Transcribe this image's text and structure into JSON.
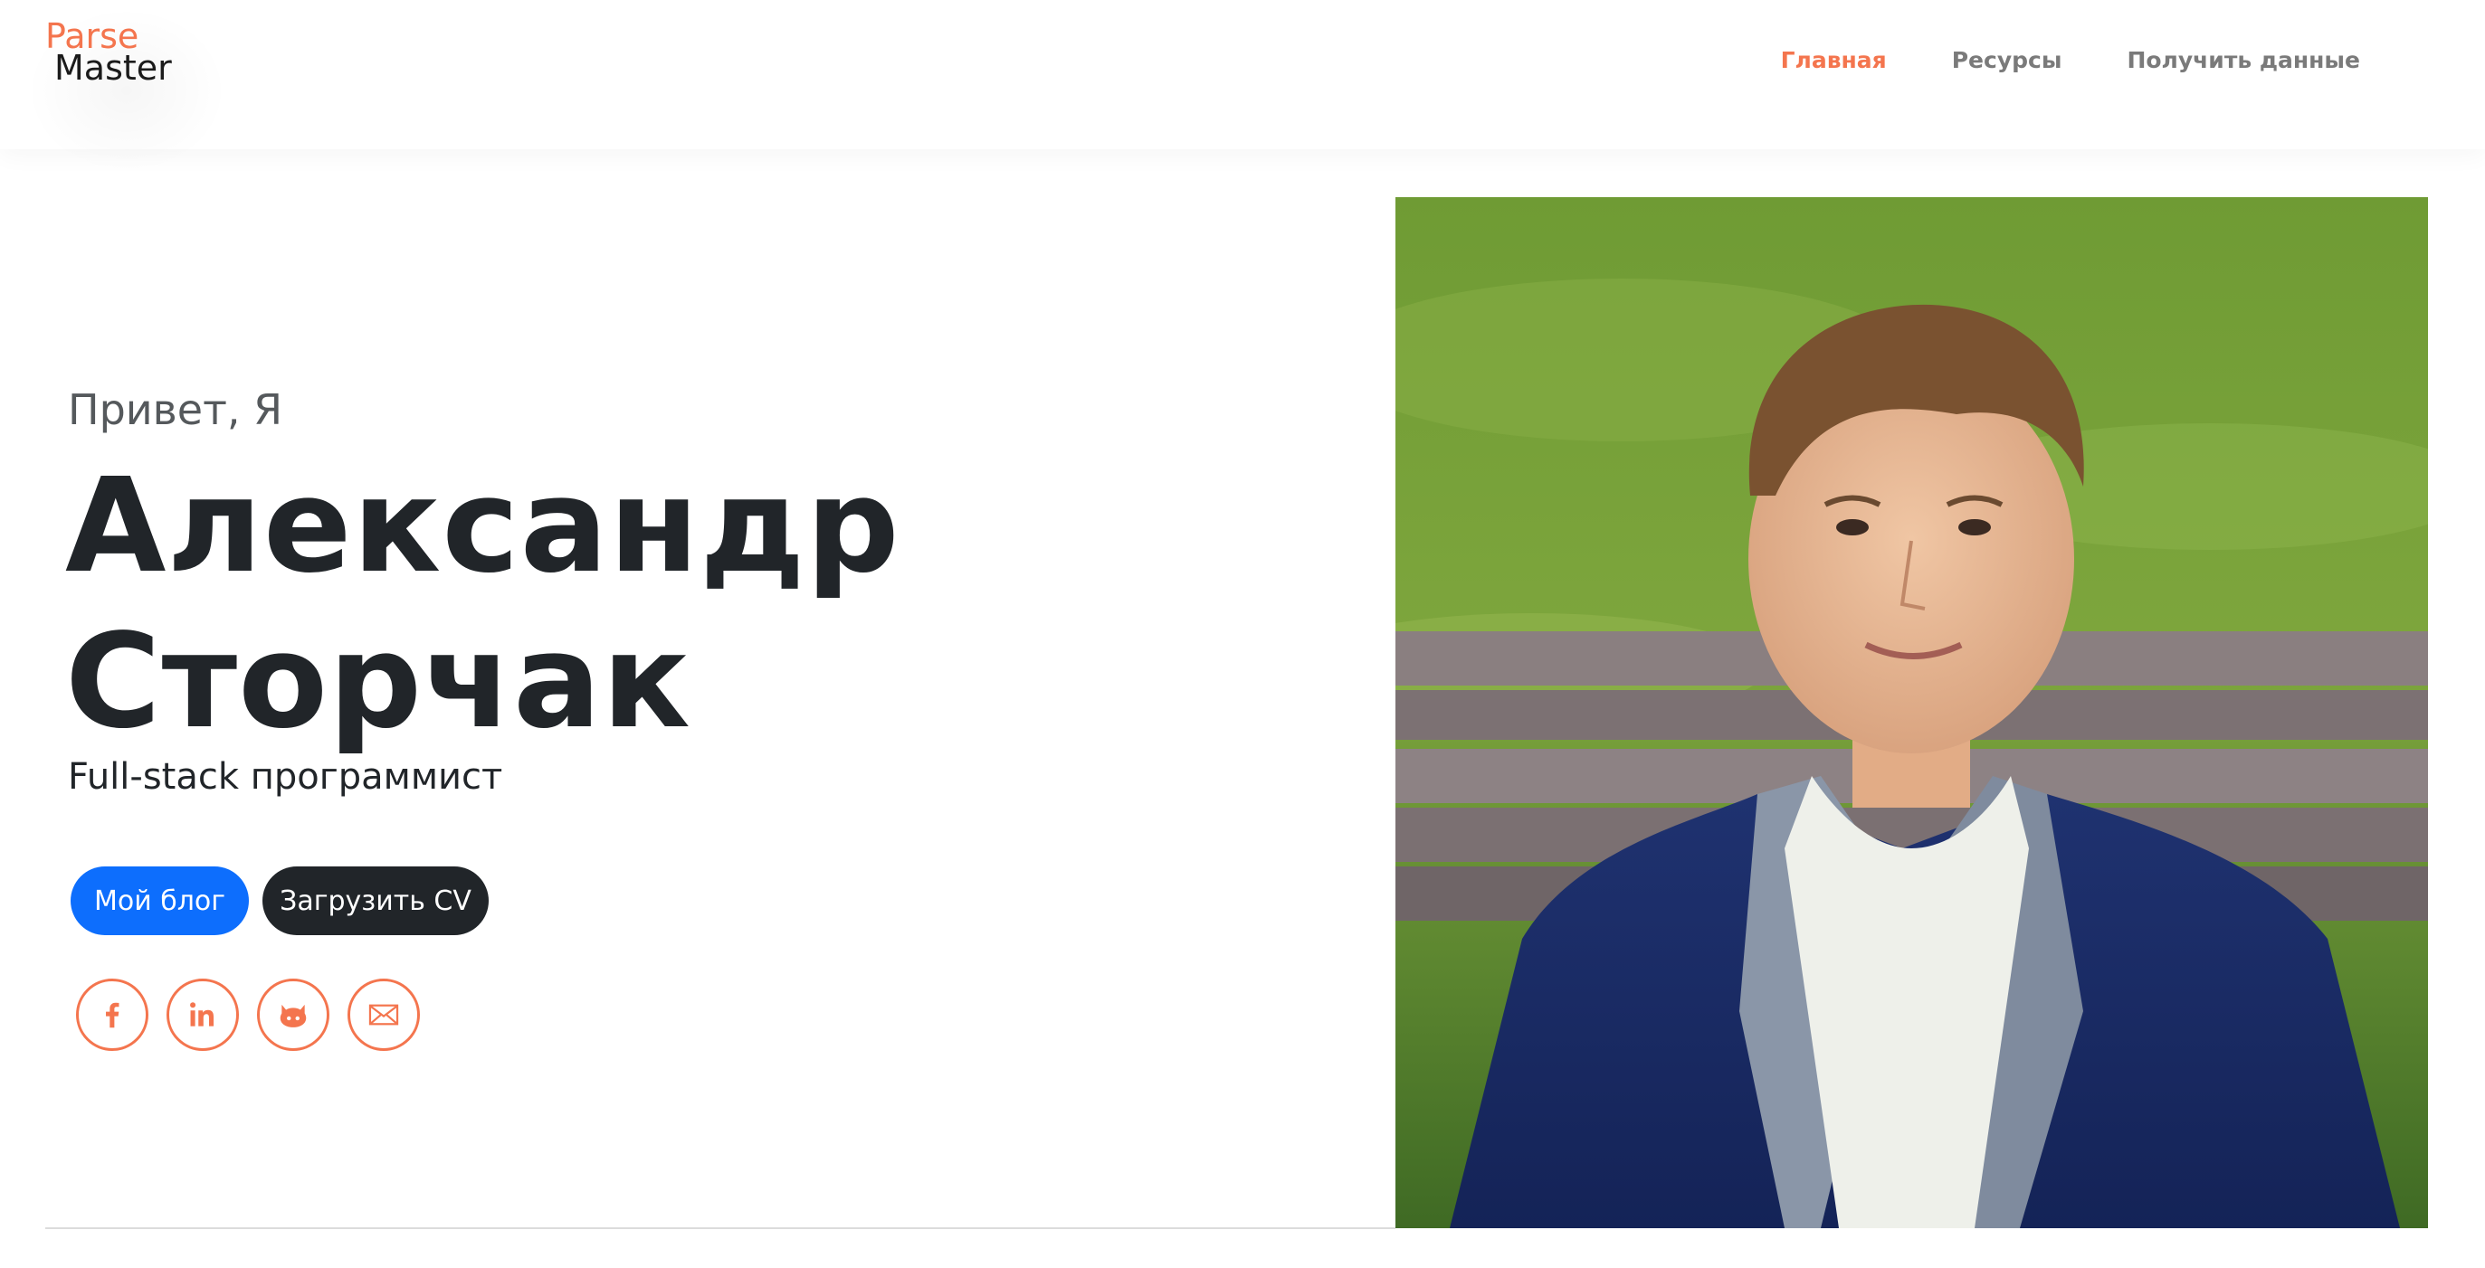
{
  "header": {
    "logo_top": "Parse",
    "logo_bottom": "Master",
    "nav": [
      {
        "label": "Главная",
        "active": true
      },
      {
        "label": "Ресурсы",
        "active": false
      },
      {
        "label": "Получить данные",
        "active": false
      }
    ]
  },
  "hero": {
    "greeting": "Привет, Я",
    "name_first": "Александр",
    "name_last": "Сторчак",
    "role": "Full-stack программист",
    "buttons": {
      "blog_label": "Мой блог",
      "cv_label": "Загрузить CV"
    },
    "socials": [
      {
        "icon": "facebook-icon"
      },
      {
        "icon": "linkedin-icon"
      },
      {
        "icon": "github-icon"
      },
      {
        "icon": "mail-icon"
      }
    ]
  },
  "colors": {
    "accent": "#f4754e",
    "primary_button": "#0d6efd",
    "dark_button": "#212529",
    "text_dark": "#212529",
    "nav_text": "#7a7a7a"
  }
}
